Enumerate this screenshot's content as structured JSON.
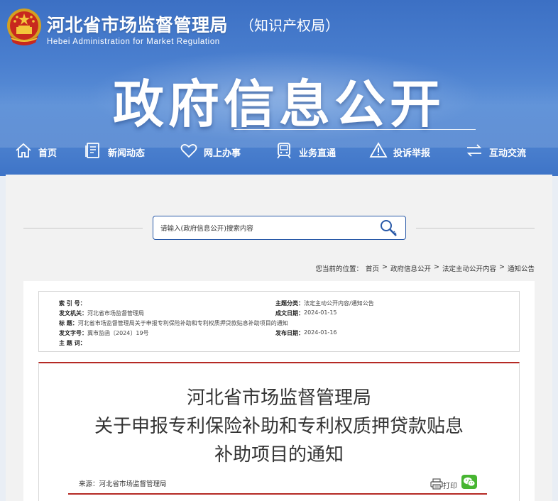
{
  "header": {
    "site_title": "河北省市场监督管理局",
    "site_subtitle": "（知识产权局）",
    "site_title_en": "Hebei Administration for Market Regulation",
    "section_title": "政府信息公开",
    "emblem": "national-emblem-icon"
  },
  "nav": {
    "items": [
      {
        "label": "首页",
        "icon": "home-icon"
      },
      {
        "label": "新闻动态",
        "icon": "document-icon"
      },
      {
        "label": "网上办事",
        "icon": "heart-icon"
      },
      {
        "label": "业务直通",
        "icon": "train-icon"
      },
      {
        "label": "投诉举报",
        "icon": "warning-icon"
      },
      {
        "label": "互动交流",
        "icon": "exchange-icon"
      }
    ]
  },
  "search": {
    "placeholder": "请输入(政府信息公开)搜索内容",
    "icon": "search-icon"
  },
  "breadcrumb": {
    "prefix": "您当前的位置：",
    "items": [
      "首页",
      "政府信息公开",
      "法定主动公开内容",
      "通知公告"
    ],
    "separator": ">"
  },
  "meta": {
    "index_label": "索  引  号：",
    "index_value": "",
    "category_label": "主题分类：",
    "category_value": "法定主动公开内容/通知公告",
    "issuer_label": "发文机关：",
    "issuer_value": "河北省市场监督管理局",
    "created_label": "成文日期：",
    "created_value": "2024-01-15",
    "title_label": "标        题：",
    "title_value": "河北省市场监督管理局关于申报专利保险补助和专利权质押贷款贴息补助项目的通知",
    "doc_no_label": "发文字号：",
    "doc_no_value": "冀市监函〔2024〕19号",
    "published_label": "发布日期：",
    "published_value": "2024-01-16",
    "keywords_label": "主  题  词：",
    "keywords_value": ""
  },
  "article": {
    "title_line1": "河北省市场监督管理局",
    "title_line2": "关于申报专利保险补助和专利权质押贷款贴息",
    "title_line3": "补助项目的通知",
    "source": "来源：河北省市场监督管理局",
    "print_label": "打印",
    "wechat_icon": "wechat-icon"
  },
  "colors": {
    "banner_blue": "#3c70c4",
    "accent_red": "#b52a24",
    "search_border": "#2a5aa8",
    "wechat_green": "#47b531"
  }
}
